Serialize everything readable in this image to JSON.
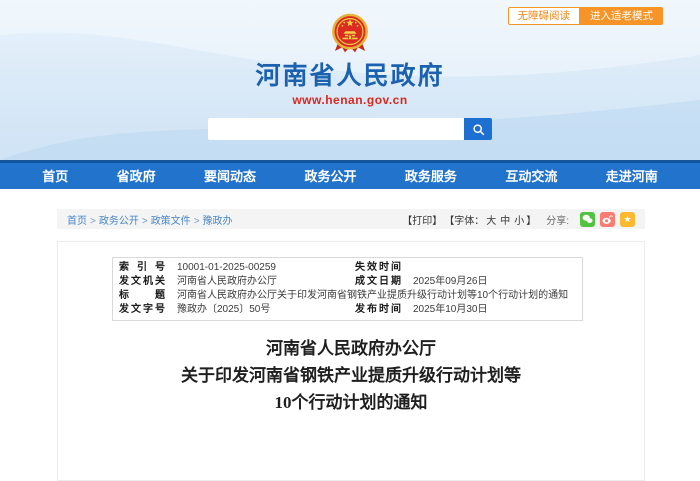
{
  "top_bar": {
    "accessibility_button": "无障碍阅读",
    "elder_mode_button": "进入适老模式"
  },
  "header": {
    "site_title": "河南省人民政府",
    "site_url": "www.henan.gov.cn",
    "search_value": ""
  },
  "nav_items": [
    "首页",
    "省政府",
    "要闻动态",
    "政务公开",
    "政务服务",
    "互动交流",
    "走进河南"
  ],
  "breadcrumb": {
    "separator": ">",
    "items": [
      "首页",
      "政务公开",
      "政策文件",
      "豫政办"
    ]
  },
  "toolbar": {
    "print_label": "【打印】",
    "font_prefix": "【字体：",
    "font_sizes": [
      "大",
      "中",
      "小"
    ],
    "font_suffix": "】",
    "share_label": "分享:",
    "share_icons": [
      "wechat-share-icon",
      "weibo-share-icon",
      "favorite-star-icon"
    ],
    "star_glyph": "★"
  },
  "doc_meta": {
    "rows": [
      {
        "label": "索引号",
        "value": "10001-01-2025-00259",
        "label2": "失效时间",
        "value2": ""
      },
      {
        "label": "发文机关",
        "value": "河南省人民政府办公厅",
        "label2": "成文日期",
        "value2": "2025年09月26日"
      },
      {
        "label": "标题",
        "value": "河南省人民政府办公厅关于印发河南省钢铁产业提质升级行动计划等10个行动计划的通知"
      },
      {
        "label": "发文字号",
        "value": "豫政办〔2025〕50号",
        "label2": "发布时间",
        "value2": "2025年10月30日"
      }
    ]
  },
  "document": {
    "title_lines": [
      "河南省人民政府办公厅",
      "关于印发河南省钢铁产业提质升级行动计划等",
      "10个行动计划的通知"
    ]
  },
  "colors": {
    "nav_blue": "#2173cc",
    "accent_orange": "#f79428",
    "site_title_blue": "#1b61ae",
    "url_red": "#d7281e",
    "search_btn_blue": "#1d6fd2",
    "wechat_green": "#52c341",
    "weibo_red": "#f97b72",
    "star_yellow": "#fcb92e",
    "crumb_bg": "#f4f4f4"
  }
}
